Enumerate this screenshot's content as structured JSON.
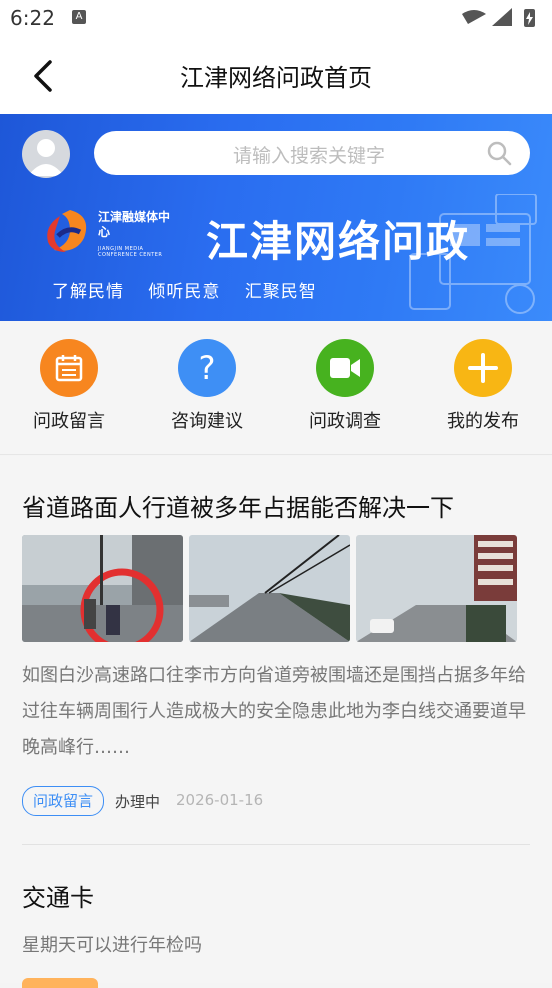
{
  "status_bar": {
    "time": "6:22",
    "notif_icon": "A"
  },
  "header": {
    "title": "江津网络问政首页"
  },
  "banner": {
    "search_placeholder": "请输入搜索关键字",
    "logo_text": "江津融媒体中心",
    "logo_subtext": "JIANGJIN MEDIA CONFERENCE CENTER",
    "headline": "江津网络问政",
    "slogans": [
      "了解民情",
      "倾听民意",
      "汇聚民智"
    ]
  },
  "quick_actions": [
    {
      "label": "问政留言",
      "icon": "calendar-icon",
      "color": "#f7861f"
    },
    {
      "label": "咨询建议",
      "icon": "question-icon",
      "color": "#3e8ff5"
    },
    {
      "label": "问政调查",
      "icon": "video-camera-icon",
      "color": "#47b21f"
    },
    {
      "label": "我的发布",
      "icon": "plus-icon",
      "color": "#f8b614"
    }
  ],
  "posts": [
    {
      "title": "省道路面人行道被多年占据能否解决一下",
      "excerpt": "如图白沙高速路口往李市方向省道旁被围墙还是围挡占据多年给过往车辆周围行人造成极大的安全隐患此地为李白线交通要道早晚高峰行……",
      "tag": "问政留言",
      "status": "办理中",
      "date": "2026-01-16"
    },
    {
      "title": "交通卡",
      "excerpt": "星期天可以进行年检吗"
    }
  ],
  "colors": {
    "accent": "#3d8ef5",
    "banner": "#2a6df0"
  }
}
